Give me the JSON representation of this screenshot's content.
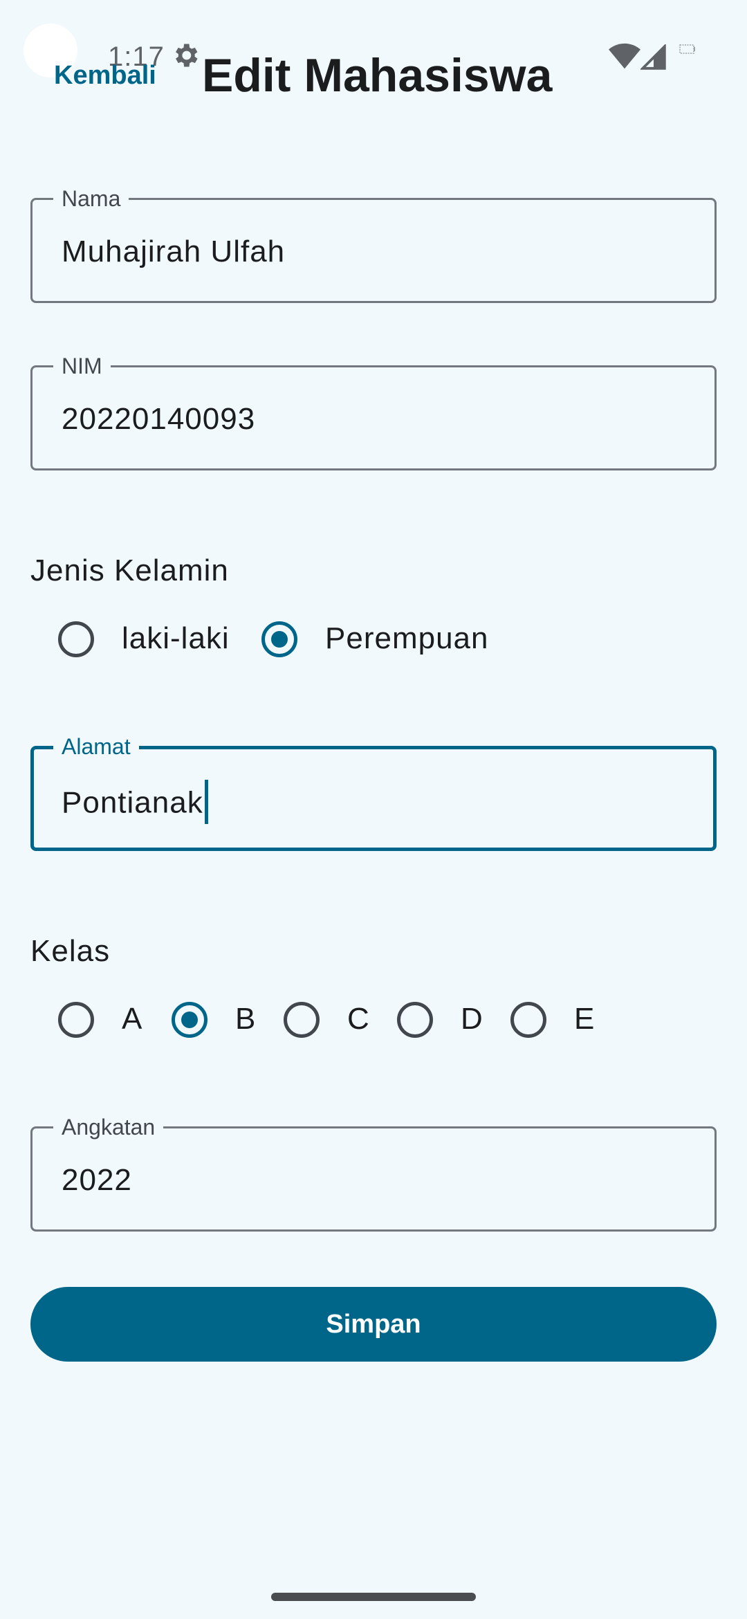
{
  "status_bar": {
    "time": "1:17",
    "icons": [
      "settings-icon",
      "wifi-icon",
      "signal-icon",
      "battery-icon"
    ]
  },
  "app_bar": {
    "back_label": "Kembali",
    "title": "Edit Mahasiswa"
  },
  "form": {
    "nama": {
      "label": "Nama",
      "value": "Muhajirah Ulfah"
    },
    "nim": {
      "label": "NIM",
      "value": "20220140093"
    },
    "jenis_kelamin": {
      "heading": "Jenis Kelamin",
      "options": [
        "laki-laki",
        "Perempuan"
      ],
      "selected": "Perempuan"
    },
    "alamat": {
      "label": "Alamat",
      "value": "Pontianak",
      "focused": true
    },
    "kelas": {
      "heading": "Kelas",
      "options": [
        "A",
        "B",
        "C",
        "D",
        "E"
      ],
      "selected": "B"
    },
    "angkatan": {
      "label": "Angkatan",
      "value": "2022"
    }
  },
  "save_label": "Simpan",
  "colors": {
    "primary": "#006689",
    "background": "#f1f9fd",
    "outline": "#72787e",
    "text": "#1a1c1e"
  }
}
